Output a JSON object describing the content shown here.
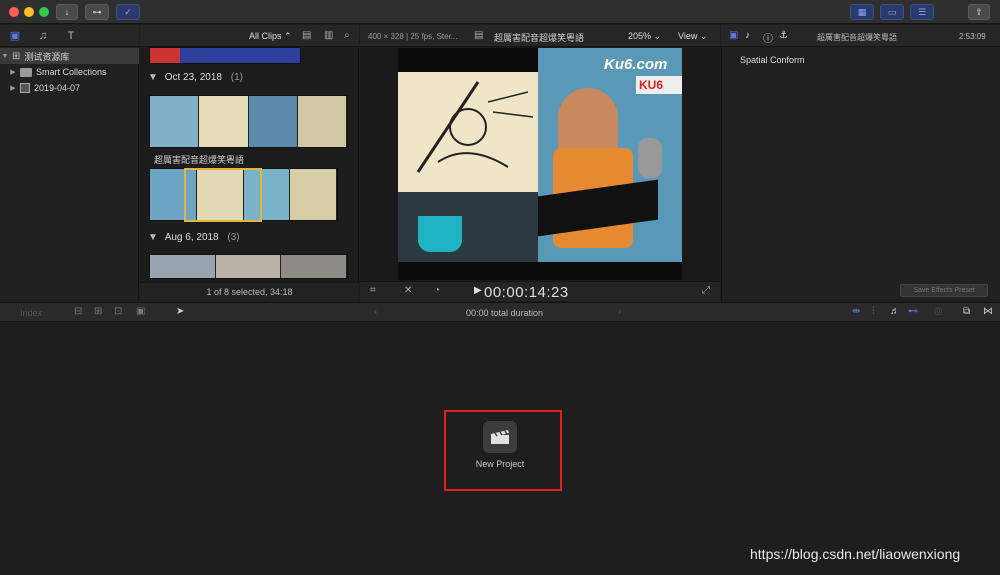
{
  "titlebar": {
    "buttons": [
      {
        "name": "import-button",
        "icon": "download-arrow-icon",
        "glyph": "↓"
      },
      {
        "name": "keywords-button",
        "icon": "key-icon",
        "glyph": "⊶"
      },
      {
        "name": "background-tasks-button",
        "icon": "check-circle-icon",
        "glyph": "✓"
      }
    ],
    "right_buttons": [
      {
        "name": "browser-toggle-button",
        "glyph": "▦"
      },
      {
        "name": "timeline-toggle-button",
        "glyph": "▭"
      },
      {
        "name": "inspector-toggle-button",
        "glyph": "☰"
      },
      {
        "name": "share-button",
        "glyph": "⇪"
      }
    ]
  },
  "library": {
    "items": [
      {
        "label": "测试资源库",
        "disclosure": "▼",
        "icon": "library-icon",
        "selected": true,
        "indent": 0
      },
      {
        "label": "Smart Collections",
        "disclosure": "▶",
        "icon": "folder-icon",
        "selected": false,
        "indent": 1
      },
      {
        "label": "2019-04-07",
        "disclosure": "▶",
        "icon": "event-icon",
        "selected": false,
        "indent": 1
      }
    ]
  },
  "browser": {
    "filter_label": "All Clips",
    "groups": [
      {
        "date": "Oct 23, 2018",
        "count": "(1)"
      },
      {
        "date": "Aug 6, 2018",
        "count": "(3)"
      }
    ],
    "clip_title": "超厲害配音超爆笑粵語",
    "status": "1 of 8 selected, 34:18"
  },
  "viewer": {
    "format": "400 × 328 | 25 fps, Ster...",
    "title": "超厲害配音超爆笑粵語",
    "zoom": "205%",
    "view_label": "View",
    "timecode": "00:00:14:23",
    "video_logo": "Ku6.com",
    "video_badge": "KU6"
  },
  "inspector": {
    "title": "超厲害配音超爆笑粵語",
    "duration": "2:53:09",
    "section": "Spatial Conform",
    "save_preset": "Save Effects Preset"
  },
  "timeline": {
    "index_label": "Index",
    "duration_label": "00:00 total duration",
    "new_project_label": "New Project"
  },
  "watermark": "https://blog.csdn.net/liaowenxiong",
  "colors": {
    "accent": "#5b78e6",
    "selection_yellow": "#e5b53a",
    "highlight_red": "#e12020"
  }
}
